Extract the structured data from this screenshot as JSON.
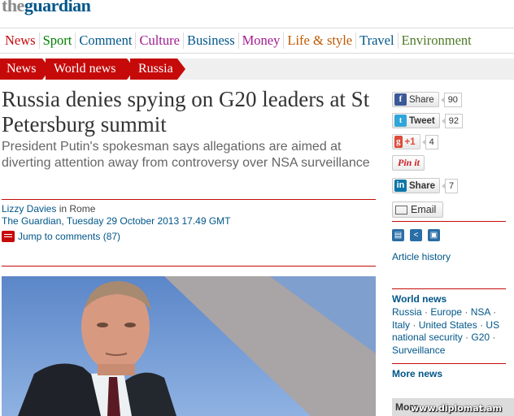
{
  "masthead": {
    "logo_prefix": "the",
    "logo_name": "guardian"
  },
  "nav": {
    "items": [
      {
        "label": "News",
        "color": "#c60a0a"
      },
      {
        "label": "Sport",
        "color": "#008000"
      },
      {
        "label": "Comment",
        "color": "#005689"
      },
      {
        "label": "Culture",
        "color": "#a1198f"
      },
      {
        "label": "Business",
        "color": "#005689"
      },
      {
        "label": "Money",
        "color": "#a1198f"
      },
      {
        "label": "Life & style",
        "color": "#c05800"
      },
      {
        "label": "Travel",
        "color": "#005689"
      },
      {
        "label": "Environment",
        "color": "#4e7a27"
      }
    ]
  },
  "breadcrumb": [
    "News",
    "World news",
    "Russia"
  ],
  "article": {
    "headline": "Russia denies spying on G20 leaders at St Petersburg summit",
    "standfirst": "President Putin's spokesman says allegations are aimed at diverting attention away from controversy over NSA surveillance",
    "author": "Lizzy Davies",
    "location": "in Rome",
    "dateline": "The Guardian, Tuesday 29 October 2013 17.49 GMT",
    "comments_link": "Jump to comments (87)"
  },
  "share": {
    "facebook": {
      "label": "Share",
      "count": "90"
    },
    "twitter": {
      "label": "Tweet",
      "count": "92"
    },
    "googleplus": {
      "label": "+1",
      "count": "4"
    },
    "pinterest": {
      "label": "Pin it"
    },
    "linkedin": {
      "label": "Share",
      "count": "7"
    },
    "email": {
      "label": "Email"
    }
  },
  "sidebar": {
    "article_history": "Article history",
    "world_news_heading": "World news",
    "tags": [
      "Russia",
      "Europe",
      "NSA",
      "Italy",
      "United States",
      "US national security",
      "G20",
      "Surveillance"
    ],
    "more_news": "More news",
    "more_box": "More"
  },
  "watermark": "www.diplomat.am",
  "colors": {
    "guardian_red": "#c60a0a",
    "guardian_blue": "#005689"
  }
}
